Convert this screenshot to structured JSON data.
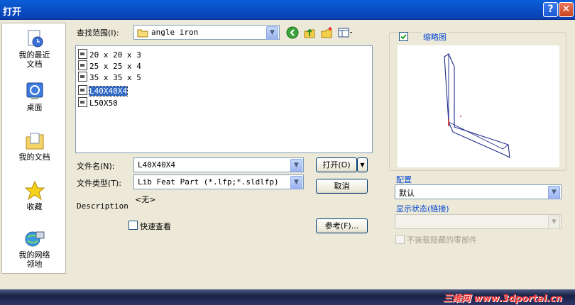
{
  "window": {
    "title": "打开",
    "help_glyph": "?",
    "close_glyph": "✕"
  },
  "places": [
    {
      "icon": "recent-documents-icon",
      "label": "我的最近文档"
    },
    {
      "icon": "desktop-icon",
      "label": "桌面"
    },
    {
      "icon": "my-documents-icon",
      "label": "我的文档"
    },
    {
      "icon": "favorites-icon",
      "label": "收藏"
    },
    {
      "icon": "network-places-icon",
      "label": "我的网络领地"
    }
  ],
  "lookin": {
    "label": "查找范围(I):",
    "value": "angle iron"
  },
  "files": [
    {
      "name": "20 x 20 x 3",
      "selected": false
    },
    {
      "name": "25 x 25 x 4",
      "selected": false
    },
    {
      "name": "35 x 35 x 5",
      "selected": false
    },
    {
      "name": "L40X40X4",
      "selected": true
    },
    {
      "name": "L50X50",
      "selected": false
    }
  ],
  "filename": {
    "label": "文件名(N):",
    "value": "L40X40X4"
  },
  "filetype": {
    "label": "文件类型(T):",
    "value": "Lib Feat Part (*.lfp;*.sldlfp)"
  },
  "buttons": {
    "open": "打开(O)",
    "cancel": "取消",
    "reference": "参考(F)..."
  },
  "none_text": "<无>",
  "description_label": "Description",
  "quickview_label": "快速查看",
  "preview": {
    "label": "缩略图",
    "checked": true
  },
  "config": {
    "label": "配置",
    "value": "默认"
  },
  "display_state": {
    "label": "显示状态(链接)",
    "value": ""
  },
  "no_load_hidden_label": "不装载隐藏的零部件",
  "watermark": "三维网 www.3dportal.cn",
  "colors": {
    "titlebar": "#0b4fc7",
    "selection": "#316ac5",
    "dialog_bg": "#ece9d8"
  }
}
